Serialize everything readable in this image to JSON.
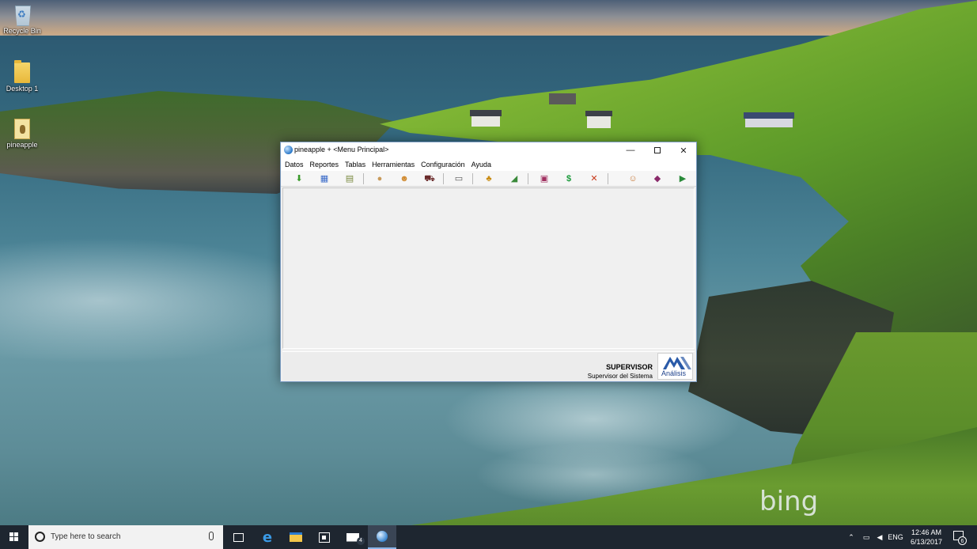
{
  "desktop": {
    "icons": [
      {
        "label": "Recycle Bin",
        "icon": "recycle-bin-icon"
      },
      {
        "label": "Desktop 1",
        "icon": "folder-icon"
      },
      {
        "label": "pineapple",
        "icon": "pineapple-file-icon"
      }
    ],
    "watermark": "bing"
  },
  "window": {
    "title": "pineapple + <Menu Principal>",
    "controls": {
      "minimize": "—",
      "close": "✕"
    },
    "menu": [
      "Datos",
      "Reportes",
      "Tablas",
      "Herramientas",
      "Configuración",
      "Ayuda"
    ],
    "toolbar": [
      {
        "icon": "green-arrow-down-icon",
        "glyph": "⬇",
        "color": "#3a9a2a"
      },
      {
        "icon": "calendar-grid-icon",
        "glyph": "▦",
        "color": "#3a6ac8"
      },
      {
        "icon": "document-icon",
        "glyph": "▤",
        "color": "#7a8a40"
      },
      {
        "icon": "money-bag-icon",
        "glyph": "●",
        "color": "#c89a5a"
      },
      {
        "icon": "person-icon",
        "glyph": "☻",
        "color": "#d08a30"
      },
      {
        "icon": "tractor-icon",
        "glyph": "⛟",
        "color": "#6a2a2a"
      },
      {
        "icon": "list-window-icon",
        "glyph": "▭",
        "color": "#555555"
      },
      {
        "icon": "pineapple-icon",
        "glyph": "♣",
        "color": "#c88a10"
      },
      {
        "icon": "chart-up-icon",
        "glyph": "◢",
        "color": "#3a8a3a"
      },
      {
        "icon": "calculator-icon",
        "glyph": "▣",
        "color": "#a03060"
      },
      {
        "icon": "dollar-icon",
        "glyph": "$",
        "color": "#1a9a3a"
      },
      {
        "icon": "tools-icon",
        "glyph": "✕",
        "color": "#c83a1a"
      },
      {
        "icon": "user-card-icon",
        "glyph": "☺",
        "color": "#c87a3a"
      },
      {
        "icon": "book-icon",
        "glyph": "◆",
        "color": "#8a2a6a"
      },
      {
        "icon": "exit-door-icon",
        "glyph": "▶",
        "color": "#2a8a3a"
      }
    ],
    "status": {
      "user": "SUPERVISOR",
      "role": "Supervisor del Sistema",
      "logo_text": "Análisis"
    }
  },
  "taskbar": {
    "search_placeholder": "Type here to search",
    "mail_badge": "4",
    "language": "ENG",
    "time": "12:46 AM",
    "date": "6/13/2017",
    "notification_count": "6",
    "accent": "#8ab4e8"
  }
}
